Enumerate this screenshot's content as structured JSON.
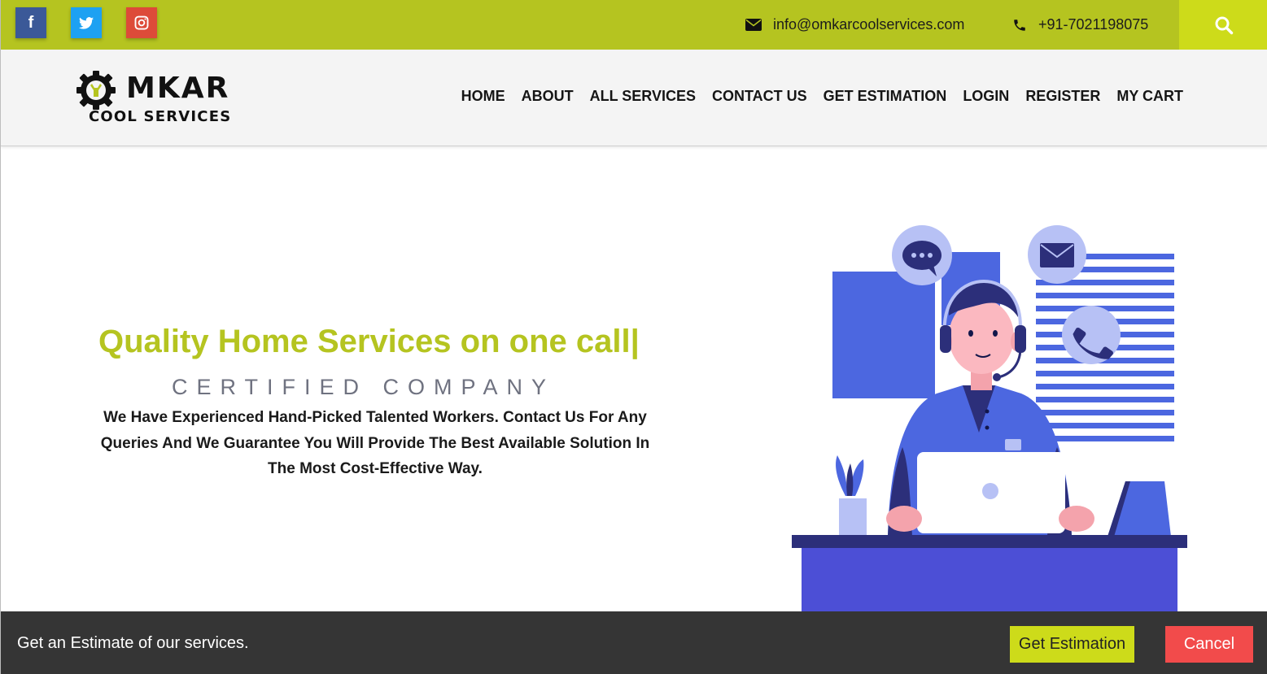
{
  "topbar": {
    "social": [
      {
        "name": "facebook",
        "glyph": "f"
      },
      {
        "name": "twitter",
        "glyph": ""
      },
      {
        "name": "instagram",
        "glyph": ""
      }
    ],
    "email": "info@omkarcoolservices.com",
    "phone": "+91-7021198075",
    "icons": {
      "email": "envelope-icon",
      "phone": "phone-icon",
      "search": "search-icon"
    },
    "colors": {
      "bar": "#b5c420",
      "search_bg": "#cddb1a"
    }
  },
  "brand": {
    "word": "MKAR",
    "sub": "COOL SERVICES"
  },
  "nav": {
    "items": [
      "HOME",
      "ABOUT",
      "ALL SERVICES",
      "CONTACT US",
      "GET ESTIMATION",
      "LOGIN",
      "REGISTER",
      "MY CART"
    ]
  },
  "hero": {
    "title": "Quality Home Services on one call|",
    "subtitle": "CERTIFIED COMPANY",
    "description": "We Have Experienced Hand-Picked Talented Workers. Contact Us For Any Queries And We Guarantee You Will Provide The Best Available Solution In The Most Cost-Effective Way.",
    "accent_color": "#b5c420"
  },
  "estimate_bar": {
    "text": "Get an Estimate of our services.",
    "primary_label": "Get Estimation",
    "cancel_label": "Cancel",
    "colors": {
      "primary": "#cddb1a",
      "cancel": "#f24b4b",
      "bg": "#353535"
    }
  }
}
